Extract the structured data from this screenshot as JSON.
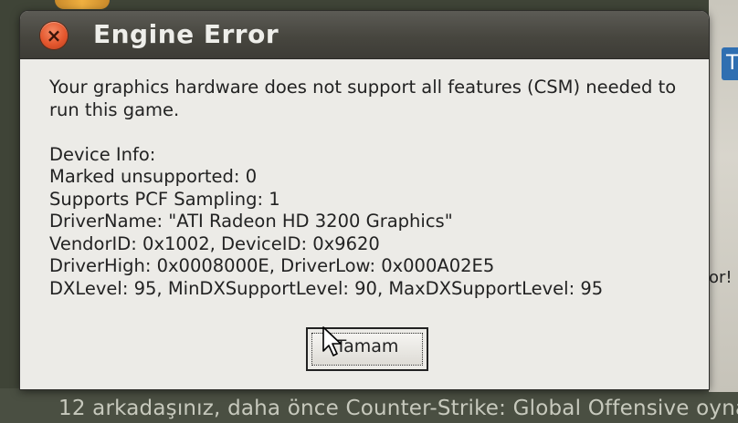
{
  "dialog": {
    "title": "Engine Error",
    "close_symbol": "×",
    "message_lines": [
      "Your graphics hardware does not support all features (CSM) needed to",
      "run this game."
    ],
    "device_info": [
      "Device Info:",
      "Marked unsupported: 0",
      "Supports PCF Sampling: 1",
      "DriverName: \"ATI Radeon HD 3200 Graphics\"",
      "VendorID: 0x1002, DeviceID: 0x9620",
      "DriverHigh: 0x0008000E, DriverLow: 0x000A02E5",
      "DXLevel: 95, MinDXSupportLevel: 90, MaxDXSupportLevel: 95"
    ],
    "ok_label": "Tamam"
  },
  "background": {
    "right_tab_text": "T",
    "right_fragment": "or!",
    "bottom_text": "12 arkadaşınız, daha önce Counter-Strike: Global Offensive oyna"
  },
  "colors": {
    "close_button": "#e4572e",
    "titlebar": "#47463f",
    "dialog_body": "#ecebe7"
  },
  "icons": {
    "close": "close-icon",
    "cursor": "mouse-pointer-icon"
  }
}
